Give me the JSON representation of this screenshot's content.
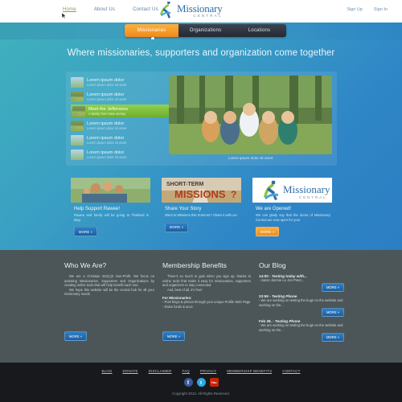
{
  "header": {
    "nav": [
      {
        "label": "Home",
        "active": true
      },
      {
        "label": "About Us",
        "active": false
      },
      {
        "label": "Contact Us",
        "active": false
      }
    ],
    "auth": [
      {
        "label": "Sign Up"
      },
      {
        "label": "Sign In"
      }
    ],
    "logo": {
      "main": "Missionary",
      "sub": "CENTRAL",
      "icon": "missionary-central-logo-icon",
      "color": "#2c6ca8"
    }
  },
  "tabs": [
    {
      "label": "Missionaries",
      "active": true
    },
    {
      "label": "Organizations",
      "active": false
    },
    {
      "label": "Locations",
      "active": false
    }
  ],
  "hero": {
    "tagline": "Where missionaries, supporters and organization come together",
    "caption": "Lorem ipsum dolor sit amet",
    "list": [
      {
        "title": "Lorem ipsum dolor",
        "sub": "Lorem ipsum dolor sit amet",
        "active": false
      },
      {
        "title": "Lorem ipsum dolor",
        "sub": "Lorem ipsum dolor sit amet",
        "active": false
      },
      {
        "title": "Meet the Jeffersons",
        "sub": "A family from New Jersey",
        "active": true
      },
      {
        "title": "Lorem ipsum dolor",
        "sub": "Lorem ipsum dolor sit amet",
        "active": false
      },
      {
        "title": "Lorem ipsum dolor",
        "sub": "Lorem ipsum dolor sit amet",
        "active": false
      },
      {
        "title": "Lorem ipsum dolor",
        "sub": "Lorem ipsum dolor sit amet",
        "active": false
      }
    ]
  },
  "cards": [
    {
      "title": "Help Support Rawee!",
      "body": "Rawee and family will be going to Thailand in May.",
      "more": "MORE »",
      "image": "family-photo",
      "accent": "blue"
    },
    {
      "title": "Share Your Story",
      "body": "Went to Missions this Summer? Share it with us!",
      "more": "MORE »",
      "image": "short-term-missions-banner",
      "accent": "blue"
    },
    {
      "title": "We are Opened!",
      "body": "We can glady say that the doors of Missionary Central are now open for you!",
      "more": "MORE »",
      "image": "missionary-central-logo",
      "accent": "orange"
    }
  ],
  "banner": {
    "line1": "SHORT-TERM",
    "line2": "MISSIONS",
    "mark": "?"
  },
  "columns": {
    "who": {
      "title": "Who We Are?",
      "p1": "We are a Christian 501(c)3 Non-Profit. We focus on assisting Missionaries, Supporters and Organizations by creating online tools that will help benefit each one.",
      "p2": "We hope this website will be the central hub for all your missionary needs.",
      "more": "MORE »"
    },
    "benefits": {
      "title": "Membership Benefits",
      "p1": "There's so much to gain when you sign up, thanks to online tools that make it easy for missionaries, supporters and organizers to stay connected.",
      "p2": "And, best of all, it's free!",
      "subhead": "For Missionaries:",
      "bullets": [
        "- Post blogs & photos through your unique Profile Web Page",
        "- Raise funds & acce"
      ],
      "more": "MORE »"
    },
    "blog": {
      "title": "Our Blog",
      "posts": [
        {
          "time": "14:00 - ",
          "title": "Testing today with...",
          "snippet": "- Jason Jimmie Le Jon Peter...",
          "more": "MORE »"
        },
        {
          "time": "23:59 - ",
          "title": "Testing Phone",
          "snippet": "- We are working on testing the bugs on the website and working on the...",
          "more": "MORE »"
        },
        {
          "time": "Feb 28. - ",
          "title": "Testing Phone",
          "snippet": "- We are working on testing the bugs on the website and working on the...",
          "more": "MORE »"
        }
      ]
    }
  },
  "footer": {
    "links": [
      {
        "label": "BLOG"
      },
      {
        "label": "DONATE"
      },
      {
        "label": "DISCLAIMER"
      },
      {
        "label": "FAQ"
      },
      {
        "label": "PRIVACY"
      },
      {
        "label": "MEMBERSHIP BENEFITS"
      },
      {
        "label": "CONTACT"
      }
    ],
    "socials": [
      {
        "name": "facebook-icon",
        "glyph": "f",
        "color": "#3b5998"
      },
      {
        "name": "twitter-icon",
        "glyph": "t",
        "color": "#2daae1"
      },
      {
        "name": "youtube-icon",
        "glyph": "You",
        "color": "#cc2200"
      }
    ],
    "copyright": "Copyright 2012. All Rights Reserved."
  }
}
